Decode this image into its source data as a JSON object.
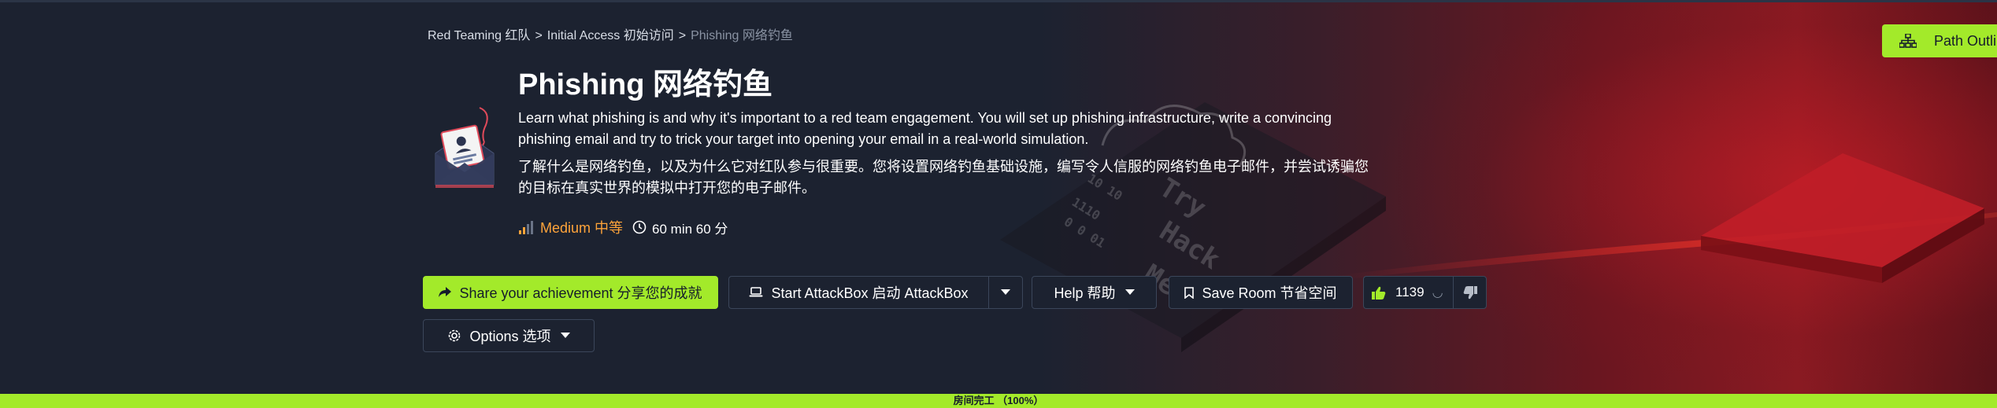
{
  "colors": {
    "accent": "#a3ea2a",
    "background": "#1c2230",
    "difficulty_medium": "#ffa43a",
    "muted_text": "#8a93a3"
  },
  "breadcrumb": {
    "items": [
      "Red Teaming 红队",
      "Initial Access 初始访问"
    ],
    "separator": ">",
    "current": "Phishing 网络钓鱼"
  },
  "room": {
    "icon": "phishing-envelope-icon",
    "title": "Phishing  网络钓鱼",
    "description_en": "Learn what phishing is and why it's important to a red team engagement. You will set up phishing infrastructure, write a convincing phishing email and try to trick your target into opening your email in a real-world simulation.",
    "description_cn": "了解什么是网络钓鱼，以及为什么它对红队参与很重要。您将设置网络钓鱼基础设施，编写令人信服的网络钓鱼电子邮件，并尝试诱骗您的目标在真实世界的模拟中打开您的电子邮件。",
    "difficulty": "Medium 中等",
    "duration": "60 min 60 分"
  },
  "actions": {
    "share_label": "Share your achievement  分享您的成就",
    "attackbox_label": "Start AttackBox  启动 AttackBox",
    "help_label": "Help  帮助",
    "save_label": "Save Room  节省空间",
    "likes_count": "1139",
    "options_label": "Options  选项"
  },
  "path_outline": {
    "label": "Path Outline"
  },
  "progress": {
    "percent": 100,
    "label": "房间完工 （100%）"
  }
}
